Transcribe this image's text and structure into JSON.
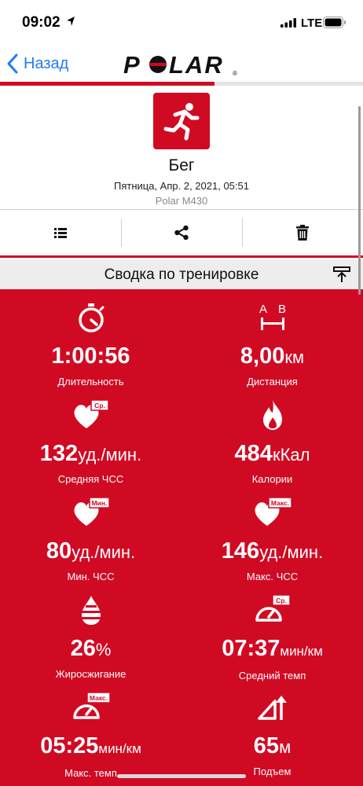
{
  "status_bar": {
    "time": "09:02",
    "network": "LTE"
  },
  "nav": {
    "back_label": "Назад",
    "logo_text": "POLAR"
  },
  "progress": {
    "fraction": 0.59
  },
  "workout": {
    "sport": "Бег",
    "datetime": "Пятница, Апр. 2, 2021, 05:51",
    "device": "Polar M430"
  },
  "actions": [
    "list-icon",
    "share-icon",
    "trash-icon"
  ],
  "summary": {
    "title": "Сводка по тренировке"
  },
  "stats": [
    {
      "icon": "stopwatch-icon",
      "value": "1:00:56",
      "unit": "",
      "label": "Длительность"
    },
    {
      "icon": "distance-ab-icon",
      "value": "8,00",
      "unit": "км",
      "label": "Дистанция",
      "icon_text_a": "A",
      "icon_text_b": "B"
    },
    {
      "icon": "heart-avg-icon",
      "value": "132",
      "unit": "уд./мин.",
      "label": "Средняя ЧСС",
      "badge": "Ср."
    },
    {
      "icon": "flame-icon",
      "value": "484",
      "unit": "кКал",
      "label": "Калории"
    },
    {
      "icon": "heart-min-icon",
      "value": "80",
      "unit": "уд./мин.",
      "label": "Мин. ЧСС",
      "badge": "Мин."
    },
    {
      "icon": "heart-max-icon",
      "value": "146",
      "unit": "уд./мин.",
      "label": "Макс. ЧСС",
      "badge": "Макс."
    },
    {
      "icon": "fat-burn-icon",
      "value": "26",
      "unit": "%",
      "label": "Жиросжигание"
    },
    {
      "icon": "pace-avg-icon",
      "value": "07:37",
      "unit": "мин/км",
      "label": "Средний темп",
      "badge": "Ср."
    },
    {
      "icon": "pace-max-icon",
      "value": "05:25",
      "unit": "мин/км",
      "label": "Макс. темп",
      "badge": "Макс."
    },
    {
      "icon": "ascent-icon",
      "value": "65",
      "unit": "м",
      "label": "Подъем"
    }
  ],
  "colors": {
    "brand_red": "#d10a24",
    "link_blue": "#1e7cf2"
  }
}
